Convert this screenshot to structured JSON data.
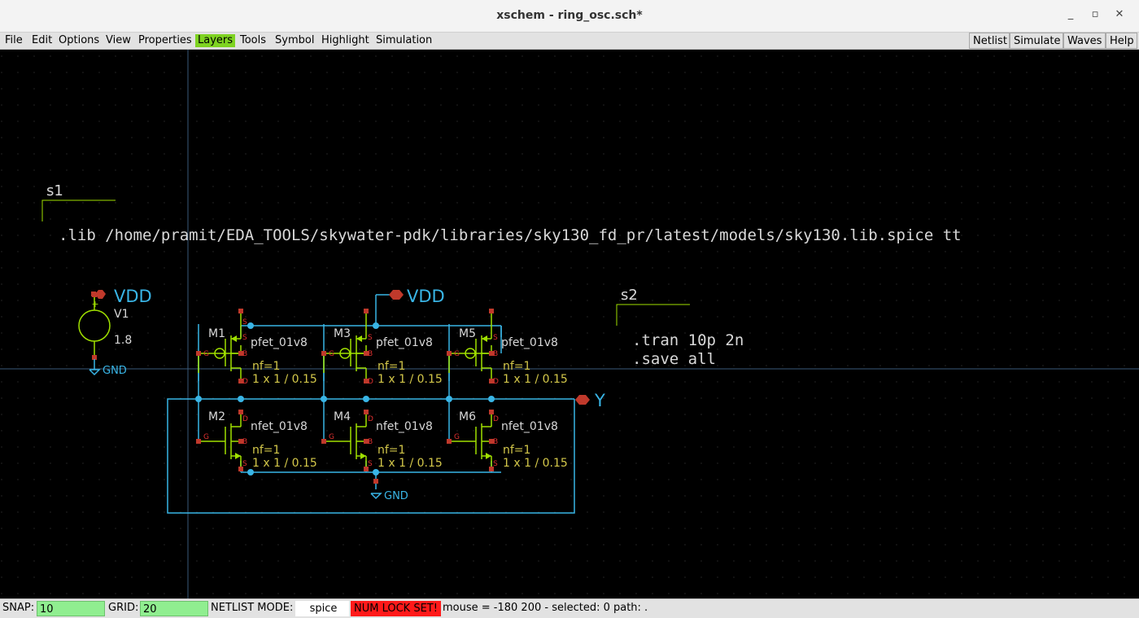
{
  "window": {
    "title": "xschem - ring_osc.sch*",
    "minimize": "_",
    "maximize": "▫",
    "close": "✕"
  },
  "menu": [
    "File",
    "Edit",
    "Options",
    "View",
    "Properties",
    "Layers",
    "Tools",
    "Symbol",
    "Highlight",
    "Simulation"
  ],
  "active_menu": "Layers",
  "right_buttons": [
    "Netlist",
    "Simulate",
    "Waves",
    "Help"
  ],
  "schematic": {
    "code_block_1": {
      "name": "s1",
      "text": ".lib /home/pramit/EDA_TOOLS/skywater-pdk/libraries/sky130_fd_pr/latest/models/sky130.lib.spice tt"
    },
    "code_block_2": {
      "name": "s2",
      "line1": ".tran 10p 2n",
      "line2": ".save all"
    },
    "vsource": {
      "name": "V1",
      "value": "1.8",
      "plus": "+"
    },
    "net_labels": {
      "vdd_1": "VDD",
      "vdd_2": "VDD",
      "gnd_1": "GND",
      "gnd_2": "GND",
      "out": "Y"
    },
    "transistors": [
      {
        "name": "M1",
        "model": "pfet_01v8",
        "nf": "nf=1",
        "size": "1 x 1 / 0.15"
      },
      {
        "name": "M3",
        "model": "pfet_01v8",
        "nf": "nf=1",
        "size": "1 x 1 / 0.15"
      },
      {
        "name": "M5",
        "model": "pfet_01v8",
        "nf": "nf=1",
        "size": "1 x 1 / 0.15"
      },
      {
        "name": "M2",
        "model": "nfet_01v8",
        "nf": "nf=1",
        "size": "1 x 1 / 0.15"
      },
      {
        "name": "M4",
        "model": "nfet_01v8",
        "nf": "nf=1",
        "size": "1 x 1 / 0.15"
      },
      {
        "name": "M6",
        "model": "nfet_01v8",
        "nf": "nf=1",
        "size": "1 x 1 / 0.15"
      }
    ],
    "pin_letters": {
      "g": "G",
      "s": "S",
      "b": "B",
      "d": "D"
    }
  },
  "status": {
    "snap_label": "SNAP:",
    "snap_value": "10",
    "grid_label": "GRID:",
    "grid_value": "20",
    "netlist_label": "NETLIST MODE:",
    "netlist_value": "spice",
    "numlock": "NUM LOCK SET!",
    "info": "mouse = -180 200 - selected: 0 path: ."
  },
  "colors": {
    "wire": "#39b5e6",
    "pin": "#c0392b",
    "device": "#a0e000",
    "attr": "#d4c84a",
    "text": "#d8d8d8",
    "grid": "#3a3a3a"
  }
}
